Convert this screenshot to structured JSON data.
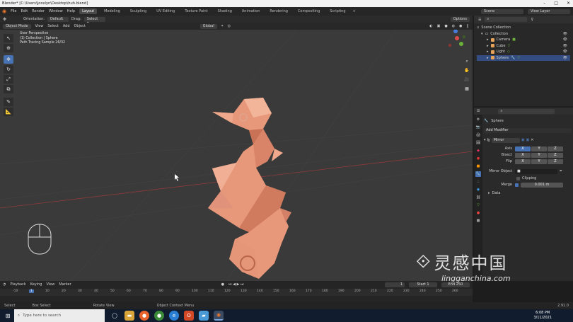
{
  "window": {
    "title": "Blender* [C:\\Users\\Jocelyn\\Desktop\\huh.blend]"
  },
  "menu": {
    "items": [
      "File",
      "Edit",
      "Render",
      "Window",
      "Help"
    ],
    "workspaces": [
      "Layout",
      "Modeling",
      "Sculpting",
      "UV Editing",
      "Texture Paint",
      "Shading",
      "Animation",
      "Rendering",
      "Compositing",
      "Scripting"
    ],
    "add_tab": "+",
    "scene": "Scene",
    "view_layer": "View Layer"
  },
  "tool_header": {
    "orientation_label": "Orientation:",
    "orientation": "Default",
    "drag_label": "Drag:",
    "drag": "Select Box",
    "options": "Options"
  },
  "viewport": {
    "mode": "Object Mode",
    "menus": [
      "View",
      "Select",
      "Add",
      "Object"
    ],
    "transform": "Global",
    "info_lines": [
      "User Perspective",
      "(1) Collection | Sphere",
      "Path Tracing Sample 26/32"
    ]
  },
  "outliner": {
    "root": "Scene Collection",
    "collection": "Collection",
    "items": [
      {
        "name": "Camera",
        "color": "#e8a35a"
      },
      {
        "name": "Cube",
        "color": "#e8a35a"
      },
      {
        "name": "Light",
        "color": "#e8a35a"
      },
      {
        "name": "Sphere",
        "color": "#e8a35a"
      }
    ]
  },
  "properties": {
    "object_name": "Sphere",
    "add_modifier": "Add Modifier",
    "modifier_name": "Mirror",
    "rows": [
      {
        "label": "Axis",
        "values": [
          "X",
          "Y",
          "Z"
        ]
      },
      {
        "label": "Bisect",
        "values": [
          "X",
          "Y",
          "Z"
        ]
      },
      {
        "label": "Flip",
        "values": [
          "X",
          "Y",
          "Z"
        ]
      }
    ],
    "mirror_object_label": "Mirror Object",
    "clipping_label": "Clipping",
    "merge_label": "Merge",
    "merge_value": "0.001 m",
    "data_label": "Data"
  },
  "timeline": {
    "menus": [
      "Playback",
      "Keying",
      "View",
      "Marker"
    ],
    "current_frame": "1",
    "start_label": "Start",
    "start": "1",
    "end_label": "End",
    "end": "250",
    "ticks": [
      "-10",
      "1",
      "10",
      "20",
      "30",
      "40",
      "50",
      "60",
      "70",
      "80",
      "90",
      "100",
      "110",
      "120",
      "130",
      "140",
      "150",
      "160",
      "170",
      "180",
      "190",
      "200",
      "210",
      "220",
      "230",
      "240",
      "250",
      "260"
    ]
  },
  "status": {
    "items": [
      "Select",
      "Box Select",
      "Rotate View",
      "Object Context Menu"
    ],
    "version": "2.91.0"
  },
  "taskbar": {
    "search_placeholder": "Type here to search",
    "time": "6:08 PM",
    "date": "3/11/2021"
  },
  "watermark": {
    "title": "灵感中国",
    "url": "lingganchina.com"
  },
  "colors": {
    "accent": "#4772b3",
    "object": "#e8987a",
    "selection": "#f0a040"
  }
}
